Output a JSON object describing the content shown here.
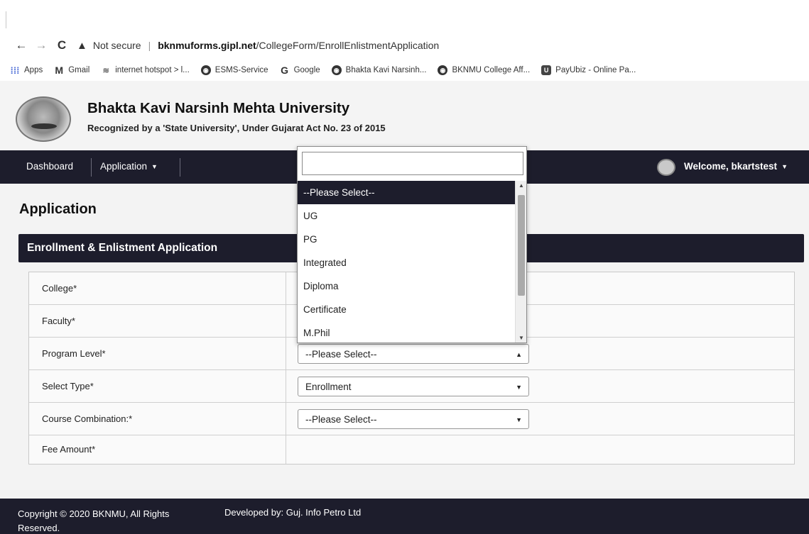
{
  "browser": {
    "address_warning": "Not secure",
    "url_domain": "bknmuforms.gipl.net",
    "url_path": "/CollegeForm/EnrollEnlistmentApplication",
    "bookmarks": [
      {
        "label": "Apps",
        "icon": "apps-grid-icon"
      },
      {
        "label": "Gmail",
        "icon": "gmail-icon"
      },
      {
        "label": "internet hotspot > l...",
        "icon": "hotspot-icon"
      },
      {
        "label": "ESMS-Service",
        "icon": "globe-icon"
      },
      {
        "label": "Google",
        "icon": "google-icon"
      },
      {
        "label": "Bhakta Kavi Narsinh...",
        "icon": "globe-icon"
      },
      {
        "label": "BKNMU College Aff...",
        "icon": "globe-icon"
      },
      {
        "label": "PayUbiz - Online Pa...",
        "icon": "payubiz-icon"
      }
    ]
  },
  "site": {
    "name": "Bhakta Kavi Narsinh Mehta University",
    "subtitle": "Recognized by a 'State University', Under Gujarat Act No. 23 of 2015"
  },
  "nav": {
    "dashboard": "Dashboard",
    "application": "Application",
    "welcome": "Welcome, bkartstest"
  },
  "page": {
    "title": "Application",
    "panel_title": "Enrollment & Enlistment Application"
  },
  "form": {
    "college_label": "College*",
    "faculty_label": "Faculty*",
    "program_level_label": "Program Level*",
    "program_level_value": "--Please Select--",
    "select_type_label": "Select Type*",
    "select_type_value": "Enrollment",
    "course_combination_label": "Course Combination:*",
    "course_combination_value": "--Please Select--",
    "fee_amount_label": "Fee Amount*"
  },
  "dropdown": {
    "search_value": "",
    "options": [
      "--Please Select--",
      "UG",
      "PG",
      "Integrated",
      "Diploma",
      "Certificate",
      "M.Phil"
    ],
    "selected": "--Please Select--"
  },
  "footer": {
    "copyright": "Copyright © 2020 BKNMU, All Rights Reserved.",
    "developer": "Developed by: Guj. Info Petro Ltd"
  },
  "colors": {
    "navbar": "#1d1d2c",
    "page_bg": "#f3f3f3"
  }
}
